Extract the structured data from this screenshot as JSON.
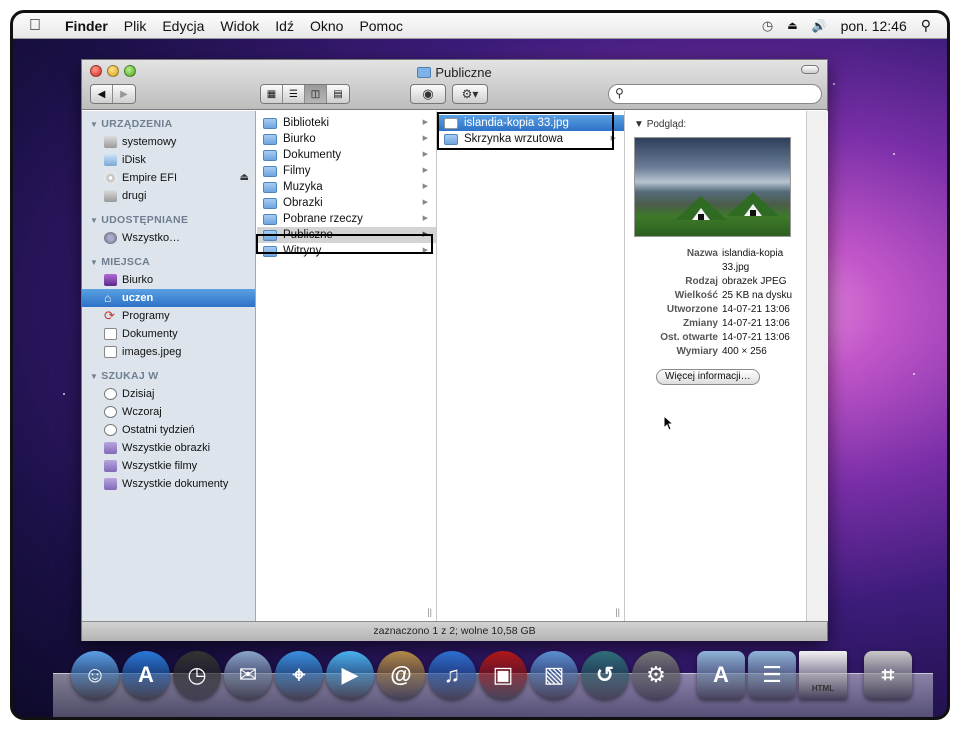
{
  "menubar": {
    "items": [
      "Finder",
      "Plik",
      "Edycja",
      "Widok",
      "Idź",
      "Okno",
      "Pomoc"
    ],
    "clock": "pon. 12:46"
  },
  "window": {
    "title": "Publiczne",
    "search_placeholder": ""
  },
  "sidebar": {
    "sections": [
      {
        "label": "URZĄDZENIA",
        "items": [
          "systemowy",
          "iDisk",
          "Empire EFI",
          "drugi"
        ]
      },
      {
        "label": "UDOSTĘPNIANE",
        "items": [
          "Wszystko…"
        ]
      },
      {
        "label": "MIEJSCA",
        "items": [
          "Biurko",
          "uczen",
          "Programy",
          "Dokumenty",
          "images.jpeg"
        ]
      },
      {
        "label": "SZUKAJ W",
        "items": [
          "Dzisiaj",
          "Wczoraj",
          "Ostatni tydzień",
          "Wszystkie obrazki",
          "Wszystkie filmy",
          "Wszystkie dokumenty"
        ]
      }
    ],
    "selected": "uczen"
  },
  "column1": {
    "items": [
      "Biblioteki",
      "Biurko",
      "Dokumenty",
      "Filmy",
      "Muzyka",
      "Obrazki",
      "Pobrane rzeczy",
      "Publiczne",
      "Witryny"
    ],
    "selected": "Publiczne"
  },
  "column2": {
    "items": [
      "islandia-kopia 33.jpg",
      "Skrzynka wrzutowa"
    ],
    "selected": "islandia-kopia 33.jpg"
  },
  "preview": {
    "title": "Podgląd:",
    "meta": [
      {
        "k": "Nazwa",
        "v": "islandia-kopia 33.jpg"
      },
      {
        "k": "Rodzaj",
        "v": "obrazek JPEG"
      },
      {
        "k": "Wielkość",
        "v": "25 KB na dysku"
      },
      {
        "k": "Utworzone",
        "v": "14-07-21 13:06"
      },
      {
        "k": "Zmiany",
        "v": "14-07-21 13:06"
      },
      {
        "k": "Ost. otwarte",
        "v": "14-07-21 13:06"
      },
      {
        "k": "Wymiary",
        "v": "400 × 256"
      }
    ],
    "more_button": "Więcej informacji…"
  },
  "status": {
    "text": "zaznaczono 1 z 2; wolne 10,58 GB"
  },
  "dock": {
    "items": [
      {
        "icon": "finder-icon",
        "color": "#5aa0e8"
      },
      {
        "icon": "app-store-icon",
        "color": "#2a78d8"
      },
      {
        "icon": "dashboard-icon",
        "color": "#333333"
      },
      {
        "icon": "mail-icon",
        "color": "#8aa4c8"
      },
      {
        "icon": "safari-icon",
        "color": "#3b8fe0"
      },
      {
        "icon": "facetime-icon",
        "color": "#4ab0f0"
      },
      {
        "icon": "address-book-icon",
        "color": "#b08a4a"
      },
      {
        "icon": "itunes-icon",
        "color": "#2d6fd0"
      },
      {
        "icon": "photo-booth-icon",
        "color": "#b01818"
      },
      {
        "icon": "iphoto-icon",
        "color": "#5b8fd0"
      },
      {
        "icon": "time-machine-icon",
        "color": "#2e6f7a"
      },
      {
        "icon": "system-preferences-icon",
        "color": "#777777"
      },
      {
        "icon": "applications-folder-icon",
        "color": "#8fb3d8"
      },
      {
        "icon": "documents-folder-icon",
        "color": "#8fb3d8"
      },
      {
        "icon": "html-file-icon",
        "color": "#f2f2f2"
      },
      {
        "icon": "trash-icon",
        "color": "#c8c8c8"
      }
    ],
    "html_label": "HTML"
  }
}
